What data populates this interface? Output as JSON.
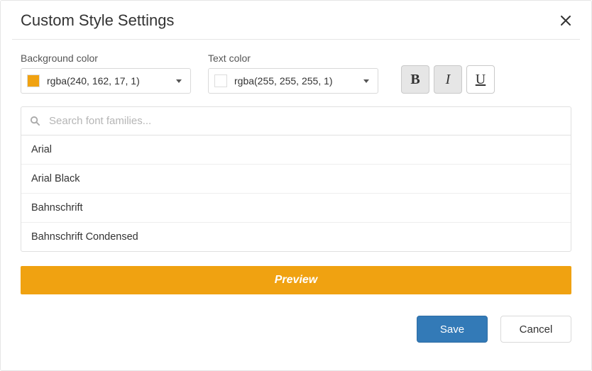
{
  "dialog": {
    "title": "Custom Style Settings"
  },
  "bg": {
    "label": "Background color",
    "value": "rgba(240, 162, 17, 1)",
    "swatch": "#f0a211"
  },
  "fg": {
    "label": "Text color",
    "value": "rgba(255, 255, 255, 1)",
    "swatch": "#ffffff"
  },
  "format": {
    "bold": {
      "label": "B",
      "active": true
    },
    "italic": {
      "label": "I",
      "active": true
    },
    "underline": {
      "label": "U",
      "active": false
    }
  },
  "search": {
    "placeholder": "Search font families..."
  },
  "fonts": [
    "Arial",
    "Arial Black",
    "Bahnschrift",
    "Bahnschrift Condensed"
  ],
  "preview": {
    "text": "Preview",
    "bg": "#f0a211",
    "color": "#ffffff",
    "bold": true,
    "italic": true,
    "underline": false
  },
  "buttons": {
    "save": "Save",
    "cancel": "Cancel"
  }
}
